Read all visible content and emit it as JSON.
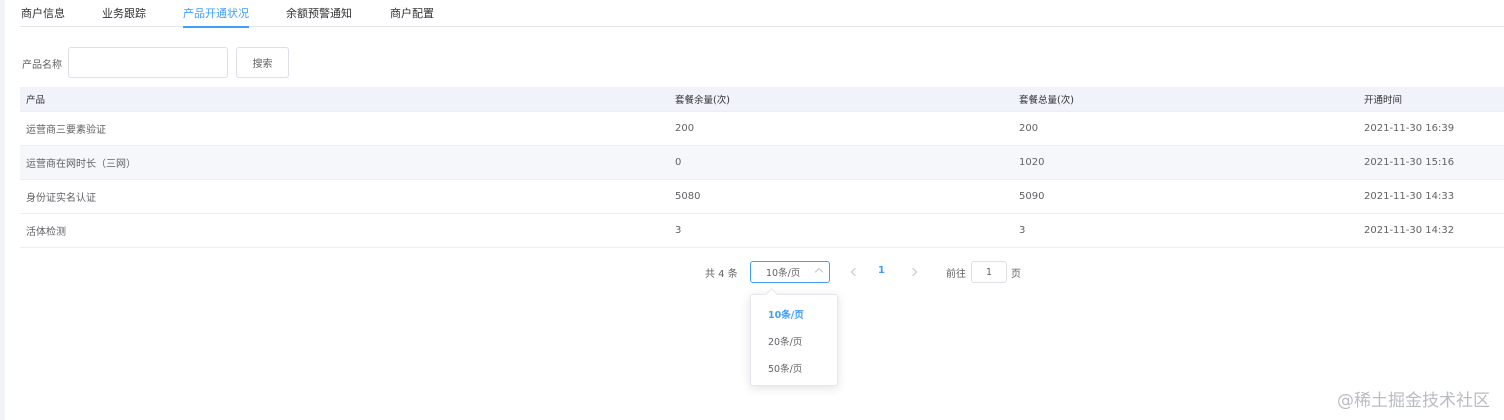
{
  "tabs": [
    {
      "label": "商户信息",
      "active": false
    },
    {
      "label": "业务跟踪",
      "active": false
    },
    {
      "label": "产品开通状况",
      "active": true
    },
    {
      "label": "余额预警通知",
      "active": false
    },
    {
      "label": "商户配置",
      "active": false
    }
  ],
  "search": {
    "label": "产品名称",
    "value": "",
    "button_label": "搜索"
  },
  "table": {
    "headers": [
      "产品",
      "套餐余量(次)",
      "套餐总量(次)",
      "开通时间"
    ],
    "rows": [
      [
        "运营商三要素验证",
        "200",
        "200",
        "2021-11-30 16:39"
      ],
      [
        "运营商在网时长（三网）",
        "0",
        "1020",
        "2021-11-30 15:16"
      ],
      [
        "身份证实名认证",
        "5080",
        "5090",
        "2021-11-30 14:33"
      ],
      [
        "活体检测",
        "3",
        "3",
        "2021-11-30 14:32"
      ]
    ]
  },
  "pagination": {
    "total_text": "共 4 条",
    "page_size": "10条/页",
    "current_page": "1",
    "goto_label": "前往",
    "goto_value": "1",
    "goto_suffix": "页",
    "size_options": [
      "10条/页",
      "20条/页",
      "50条/页"
    ]
  },
  "watermark": "@稀土掘金技术社区",
  "colors": {
    "accent": "#409eff",
    "header_bg": "#f0f3fa",
    "stripe_bg": "#f5f7fa",
    "border": "#ebeef5"
  },
  "icons": {
    "prev": "chevron-left-icon",
    "next": "chevron-right-icon",
    "select_arrow": "chevron-up-icon"
  }
}
